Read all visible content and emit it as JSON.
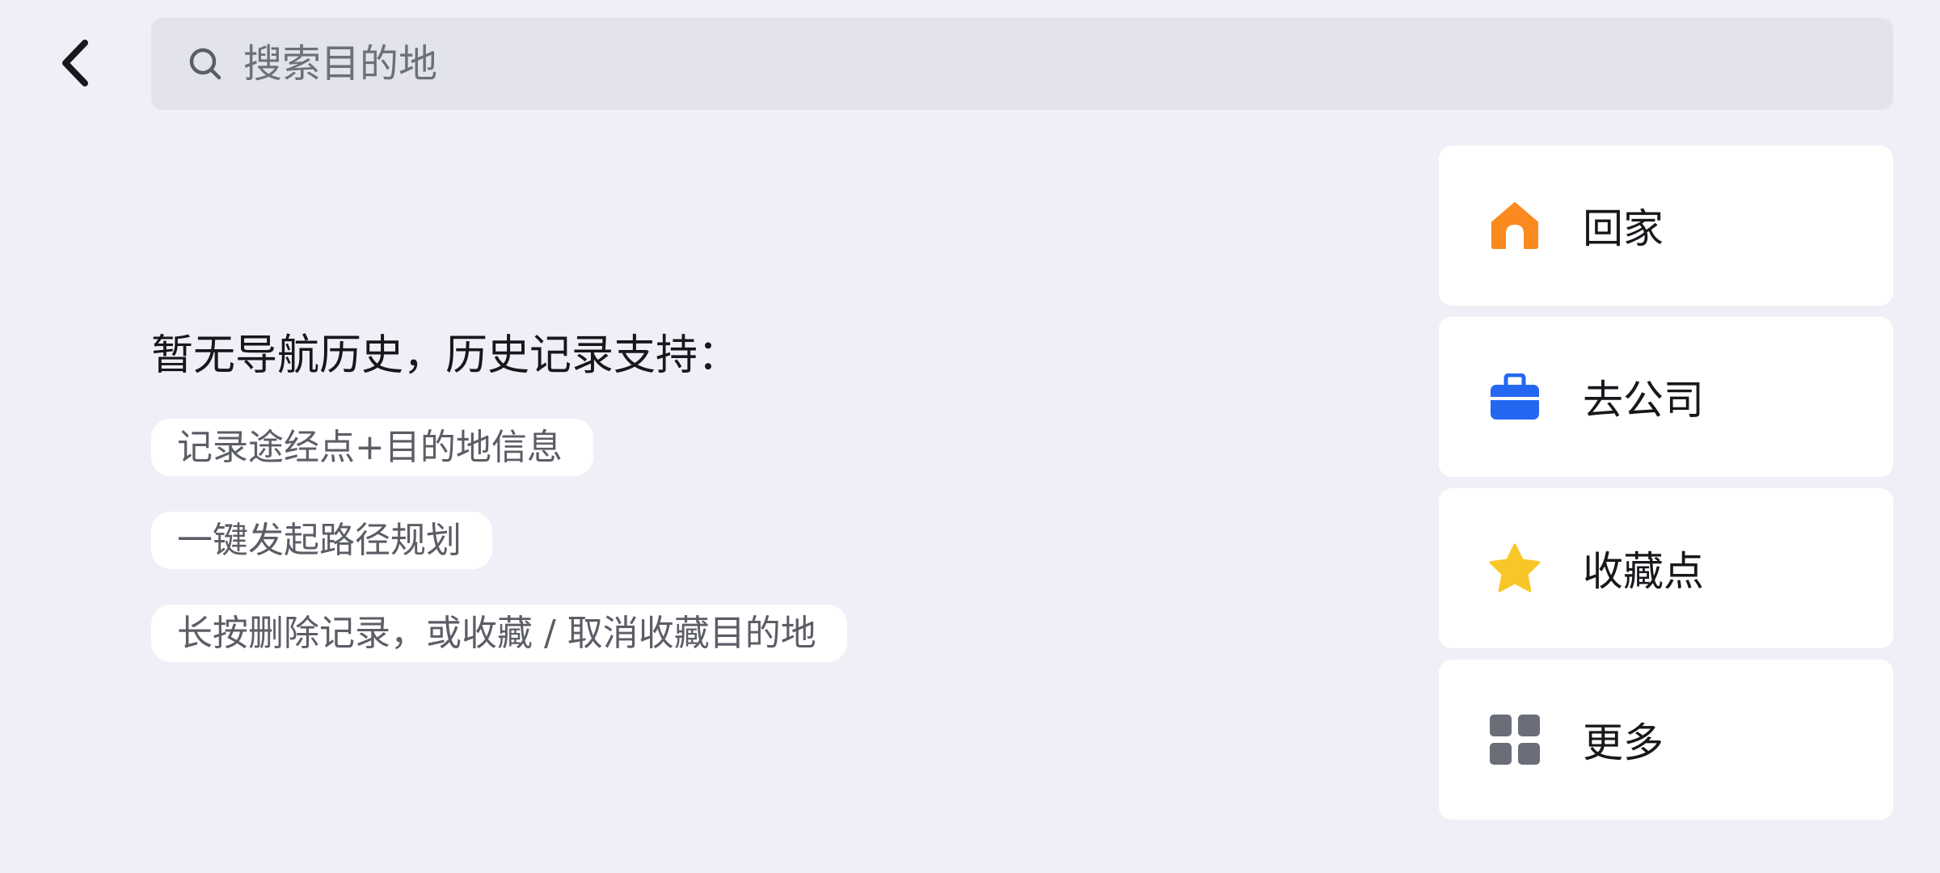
{
  "search": {
    "placeholder": "搜索目的地"
  },
  "history": {
    "empty_title": "暂无导航历史，历史记录支持：",
    "tips": [
      "记录途经点+目的地信息",
      "一键发起路径规划",
      "长按删除记录，或收藏 / 取消收藏目的地"
    ]
  },
  "quick": {
    "items": [
      {
        "label": "回家",
        "icon": "home-icon",
        "color": "#FA8A1E"
      },
      {
        "label": "去公司",
        "icon": "briefcase-icon",
        "color": "#2468F2"
      },
      {
        "label": "收藏点",
        "icon": "star-icon",
        "color": "#F8C626"
      },
      {
        "label": "更多",
        "icon": "grid-icon",
        "color": "#6B6E78"
      }
    ]
  },
  "colors": {
    "background": "#EFF0F7",
    "search_bg": "#E2E3EC",
    "card_bg": "#FFFFFF"
  }
}
